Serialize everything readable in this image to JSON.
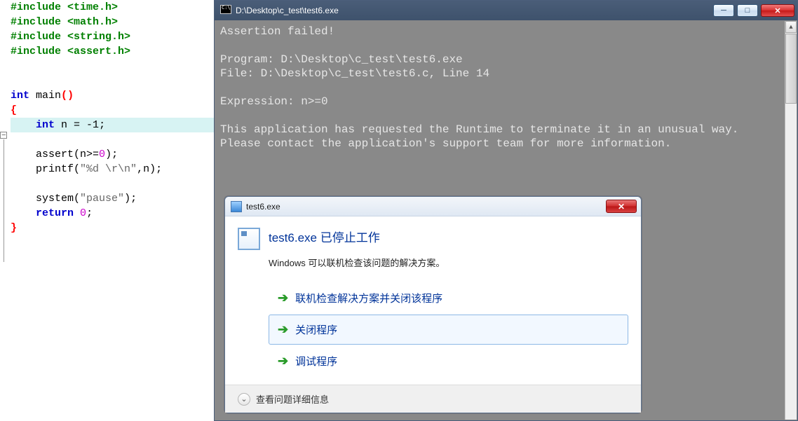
{
  "code": {
    "includes": [
      "#include <time.h>",
      "#include <math.h>",
      "#include <string.h>",
      "#include <assert.h>"
    ],
    "int": "int",
    "main": "main",
    "paren_open": "(",
    "paren_close": ")",
    "brace_open": "{",
    "brace_close": "}",
    "decl_kw": "int",
    "decl_var": " n = ",
    "decl_val": "-1",
    "semicolon": ";",
    "assert": "assert",
    "assert_arg": "(n>=",
    "zero": "0",
    "assert_close": ");",
    "printf": "printf",
    "printf_open": "(",
    "printf_str": "\"%d \\r\\n\"",
    "printf_rest": ",n);",
    "system": "system",
    "system_open": "(",
    "pause_str": "\"pause\"",
    "system_close": ");",
    "return_kw": "return",
    "return_sp": " ",
    "return_val": "0",
    "return_end": ";"
  },
  "console": {
    "title": "D:\\Desktop\\c_test\\test6.exe",
    "min": "─",
    "max": "□",
    "close": "✕",
    "line1": "Assertion failed!",
    "line2": "Program: D:\\Desktop\\c_test\\test6.exe",
    "line3": "File: D:\\Desktop\\c_test\\test6.c, Line 14",
    "line4": "Expression: n>=0",
    "line5": "This application has requested the Runtime to terminate it in an unusual way.",
    "line6": "Please contact the application's support team for more information."
  },
  "dialog": {
    "title": "test6.exe",
    "close": "✕",
    "heading": "test6.exe 已停止工作",
    "subtext": "Windows 可以联机检查该问题的解决方案。",
    "options": [
      "联机检查解决方案并关闭该程序",
      "关闭程序",
      "调试程序"
    ],
    "footer": "查看问题详细信息"
  }
}
